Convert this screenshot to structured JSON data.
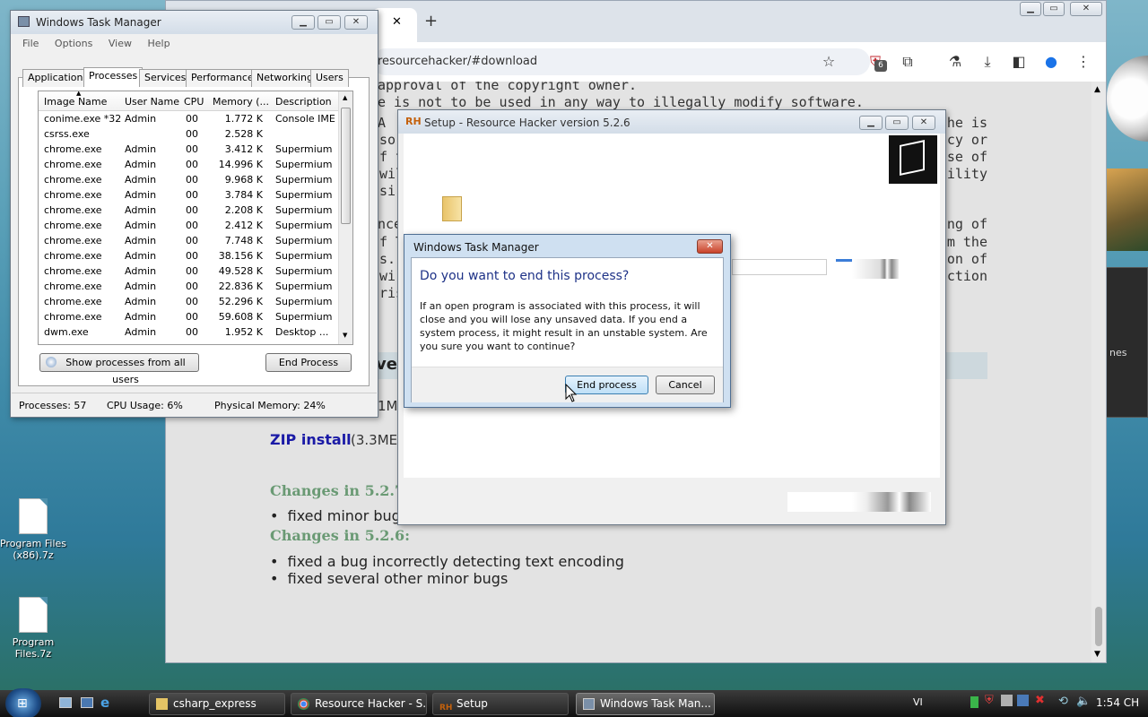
{
  "desktop": {
    "icons": [
      {
        "label": "Program Files (x86).7z"
      },
      {
        "label": "Program Files.7z"
      }
    ],
    "sidebar_fragment": "nes"
  },
  "chrome": {
    "url": "resourcehacker/#download",
    "new_tab": "+",
    "tab_close": "✕",
    "extension_badge": "6",
    "page": {
      "left_lines": [
        "approval of the copyright owner.",
        "e is not to be used in any way to illegally modify software.",
        "A",
        "so",
        "f t",
        "wil",
        "sir",
        "nce",
        "f T",
        "s. I",
        "wi",
        "ris"
      ],
      "right_lines": [
        "he is",
        "ncy or",
        "use of",
        "ibility",
        "ing of",
        "m the",
        "on of",
        "ection"
      ],
      "download_heading_fragment": "ve",
      "size_fragment": "1M",
      "zip_link": "ZIP install",
      "zip_size": "(3.3ME",
      "changes_527": "Changes in 5.2.7",
      "bullet_527": "fixed minor bug",
      "changes_526": "Changes in 5.2.6:",
      "bullets_526": [
        "fixed a bug incorrectly detecting text encoding",
        "fixed several other minor bugs"
      ]
    }
  },
  "taskmgr": {
    "title": "Windows Task Manager",
    "menu": [
      "File",
      "Options",
      "View",
      "Help"
    ],
    "tabs": [
      "Applications",
      "Processes",
      "Services",
      "Performance",
      "Networking",
      "Users"
    ],
    "columns": [
      "Image Name",
      "User Name",
      "CPU",
      "Memory (...",
      "Description"
    ],
    "rows": [
      {
        "name": "conime.exe *32",
        "user": "Admin",
        "cpu": "00",
        "mem": "1.772 K",
        "desc": "Console IME"
      },
      {
        "name": "csrss.exe",
        "user": "",
        "cpu": "00",
        "mem": "2.528 K",
        "desc": ""
      },
      {
        "name": "chrome.exe",
        "user": "Admin",
        "cpu": "00",
        "mem": "3.412 K",
        "desc": "Supermium"
      },
      {
        "name": "chrome.exe",
        "user": "Admin",
        "cpu": "00",
        "mem": "14.996 K",
        "desc": "Supermium"
      },
      {
        "name": "chrome.exe",
        "user": "Admin",
        "cpu": "00",
        "mem": "9.968 K",
        "desc": "Supermium"
      },
      {
        "name": "chrome.exe",
        "user": "Admin",
        "cpu": "00",
        "mem": "3.784 K",
        "desc": "Supermium"
      },
      {
        "name": "chrome.exe",
        "user": "Admin",
        "cpu": "00",
        "mem": "2.208 K",
        "desc": "Supermium"
      },
      {
        "name": "chrome.exe",
        "user": "Admin",
        "cpu": "00",
        "mem": "2.412 K",
        "desc": "Supermium"
      },
      {
        "name": "chrome.exe",
        "user": "Admin",
        "cpu": "00",
        "mem": "7.748 K",
        "desc": "Supermium"
      },
      {
        "name": "chrome.exe",
        "user": "Admin",
        "cpu": "00",
        "mem": "38.156 K",
        "desc": "Supermium"
      },
      {
        "name": "chrome.exe",
        "user": "Admin",
        "cpu": "00",
        "mem": "49.528 K",
        "desc": "Supermium"
      },
      {
        "name": "chrome.exe",
        "user": "Admin",
        "cpu": "00",
        "mem": "22.836 K",
        "desc": "Supermium"
      },
      {
        "name": "chrome.exe",
        "user": "Admin",
        "cpu": "00",
        "mem": "52.296 K",
        "desc": "Supermium"
      },
      {
        "name": "chrome.exe",
        "user": "Admin",
        "cpu": "00",
        "mem": "59.608 K",
        "desc": "Supermium"
      },
      {
        "name": "dwm.exe",
        "user": "Admin",
        "cpu": "00",
        "mem": "1.952 K",
        "desc": "Desktop ..."
      }
    ],
    "show_all_button": "Show processes from all users",
    "end_process_button": "End Process",
    "status": {
      "processes": "Processes: 57",
      "cpu": "CPU Usage: 6%",
      "memory": "Physical Memory: 24%"
    }
  },
  "setup": {
    "title": "Setup - Resource Hacker version 5.2.6"
  },
  "dialog": {
    "title": "Windows Task Manager",
    "heading": "Do you want to end this process?",
    "body": "If an open program is associated with this process, it will close and you will lose any unsaved data. If you end a system process, it might result in an unstable system. Are you sure you want to continue?",
    "end_button": "End process",
    "cancel_button": "Cancel"
  },
  "taskbar": {
    "items": [
      {
        "label": "csharp_express"
      },
      {
        "label": "Resource Hacker - S..."
      },
      {
        "label": "Setup"
      },
      {
        "label": "Windows Task Man..."
      }
    ],
    "lang": "VI",
    "time": "1:54 CH"
  },
  "colors": {
    "link": "#1a1aa6",
    "green_heading": "#6a9a74",
    "dialog_heading": "#1e3287"
  }
}
